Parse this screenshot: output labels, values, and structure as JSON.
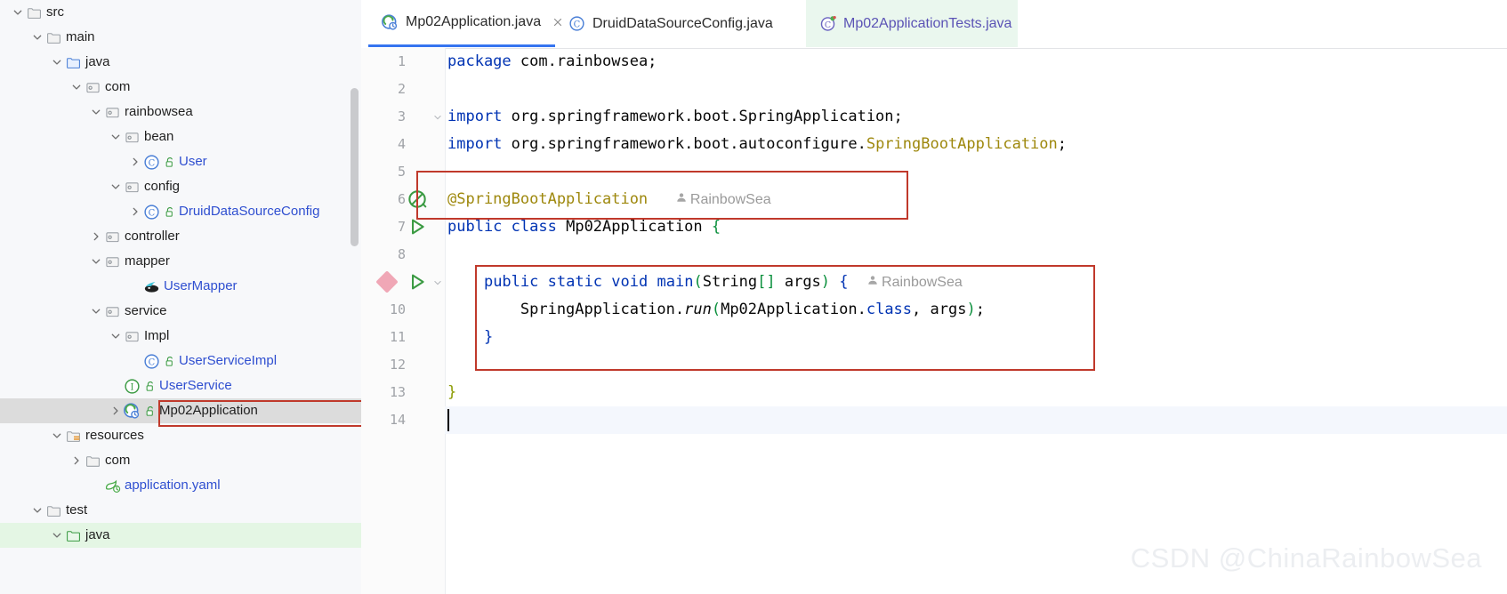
{
  "window": {
    "app": "IntelliJ IDEA",
    "watermark": "CSDN @ChinaRainbowSea"
  },
  "colors": {
    "accent_blue": "#3574f0",
    "annotation_red": "#c0392b",
    "selected_row": "#dcdcdc",
    "test_root_green": "#e4f6e4",
    "tab_green": "#eaf7ee",
    "keyword_blue": "#0033b3",
    "annotation_gold": "#9e880d",
    "inlay_gray": "#9a9a9a"
  },
  "project_tree": {
    "name": "Project",
    "items": [
      {
        "label": "src",
        "indent": 2,
        "arrow": "expanded",
        "icon": "folder-icon",
        "style": "plain",
        "lock": false
      },
      {
        "label": "main",
        "indent": 3,
        "arrow": "expanded",
        "icon": "folder-icon",
        "style": "plain",
        "lock": false
      },
      {
        "label": "java",
        "indent": 4,
        "arrow": "expanded",
        "icon": "source-folder-icon",
        "style": "plain",
        "lock": false
      },
      {
        "label": "com",
        "indent": 5,
        "arrow": "expanded",
        "icon": "package-icon",
        "style": "plain",
        "lock": false
      },
      {
        "label": "rainbowsea",
        "indent": 6,
        "arrow": "expanded",
        "icon": "package-icon",
        "style": "plain",
        "lock": false
      },
      {
        "label": "bean",
        "indent": 7,
        "arrow": "expanded",
        "icon": "package-icon",
        "style": "plain",
        "lock": false
      },
      {
        "label": "User",
        "indent": 8,
        "arrow": "collapsed",
        "icon": "java-class-icon",
        "style": "blue",
        "lock": true
      },
      {
        "label": "config",
        "indent": 7,
        "arrow": "expanded",
        "icon": "package-icon",
        "style": "plain",
        "lock": false
      },
      {
        "label": "DruidDataSourceConfig",
        "indent": 8,
        "arrow": "collapsed",
        "icon": "java-class-icon",
        "style": "blue",
        "lock": true
      },
      {
        "label": "controller",
        "indent": 6,
        "arrow": "collapsed",
        "icon": "package-icon",
        "style": "plain",
        "lock": false
      },
      {
        "label": "mapper",
        "indent": 6,
        "arrow": "expanded",
        "icon": "package-icon",
        "style": "plain",
        "lock": false
      },
      {
        "label": "UserMapper",
        "indent": 8,
        "arrow": "none",
        "icon": "mybatis-mapper-icon",
        "style": "blue",
        "lock": false
      },
      {
        "label": "service",
        "indent": 6,
        "arrow": "expanded",
        "icon": "package-icon",
        "style": "plain",
        "lock": false
      },
      {
        "label": "Impl",
        "indent": 7,
        "arrow": "expanded",
        "icon": "package-icon",
        "style": "plain",
        "lock": false
      },
      {
        "label": "UserServiceImpl",
        "indent": 8,
        "arrow": "none",
        "icon": "java-class-icon",
        "style": "blue",
        "lock": true
      },
      {
        "label": "UserService",
        "indent": 7,
        "arrow": "none",
        "icon": "java-interface-icon",
        "style": "blue",
        "lock": true
      },
      {
        "label": "Mp02Application",
        "indent": 7,
        "arrow": "collapsed",
        "icon": "spring-boot-class-icon",
        "style": "plain",
        "lock": true,
        "selected": true,
        "boxed": true
      },
      {
        "label": "resources",
        "indent": 4,
        "arrow": "expanded",
        "icon": "resources-folder-icon",
        "style": "plain",
        "lock": false
      },
      {
        "label": "com",
        "indent": 5,
        "arrow": "collapsed",
        "icon": "folder-icon",
        "style": "plain",
        "lock": false
      },
      {
        "label": "application.yaml",
        "indent": 6,
        "arrow": "none",
        "icon": "yaml-spring-icon",
        "style": "blue",
        "lock": false
      },
      {
        "label": "test",
        "indent": 3,
        "arrow": "expanded",
        "icon": "folder-icon",
        "style": "plain",
        "lock": false
      },
      {
        "label": "java",
        "indent": 4,
        "arrow": "expanded",
        "icon": "test-source-folder-icon",
        "style": "plain",
        "lock": false,
        "greenroot": true
      }
    ]
  },
  "editor": {
    "tabs": [
      {
        "label": "Mp02Application.java",
        "icon": "spring-boot-class-icon",
        "active": true,
        "closable": true,
        "green": false
      },
      {
        "label": "DruidDataSourceConfig.java",
        "icon": "java-class-icon",
        "active": false,
        "closable": false,
        "green": false
      },
      {
        "label": "Mp02ApplicationTests.java",
        "icon": "java-test-class-icon",
        "active": false,
        "closable": false,
        "green": true
      }
    ],
    "line_numbers": [
      "1",
      "2",
      "3",
      "4",
      "5",
      "6",
      "7",
      "8",
      "",
      "10",
      "11",
      "12",
      "13",
      "14"
    ],
    "gutter_icons": [
      {
        "line": 6,
        "icon": "spring-bean-icon"
      },
      {
        "line": 7,
        "icon": "run-gutter-icon"
      },
      {
        "line": 9,
        "icon": "breakpoint-icon"
      },
      {
        "line": 9,
        "icon": "run-gutter-icon"
      }
    ],
    "fold_markers": [
      3,
      9
    ],
    "current_line": 14,
    "caret_line": 14,
    "lines": [
      {
        "n": "1",
        "text": "package com.rainbowsea;"
      },
      {
        "n": "2",
        "text": ""
      },
      {
        "n": "3",
        "text": "import org.springframework.boot.SpringApplication;"
      },
      {
        "n": "4",
        "text": "import org.springframework.boot.autoconfigure.SpringBootApplication;"
      },
      {
        "n": "5",
        "text": ""
      },
      {
        "n": "6",
        "text": "@SpringBootApplication",
        "inlay": "RainbowSea"
      },
      {
        "n": "7",
        "text": "public class Mp02Application {"
      },
      {
        "n": "8",
        "text": ""
      },
      {
        "n": "9",
        "text": "    public static void main(String[] args) {",
        "inlay": "RainbowSea"
      },
      {
        "n": "10",
        "text": "        SpringApplication.run(Mp02Application.class, args);"
      },
      {
        "n": "11",
        "text": "    }"
      },
      {
        "n": "12",
        "text": ""
      },
      {
        "n": "13",
        "text": "}"
      },
      {
        "n": "14",
        "text": ""
      }
    ],
    "inlay_hint": "RainbowSea",
    "annotations": [
      {
        "name": "annotation-box-springbootapplication",
        "target": "@SpringBootApplication line"
      },
      {
        "name": "annotation-box-main-method",
        "target": "main method block"
      },
      {
        "name": "annotation-box-tree-mp02application",
        "target": "Mp02Application tree node"
      }
    ]
  }
}
